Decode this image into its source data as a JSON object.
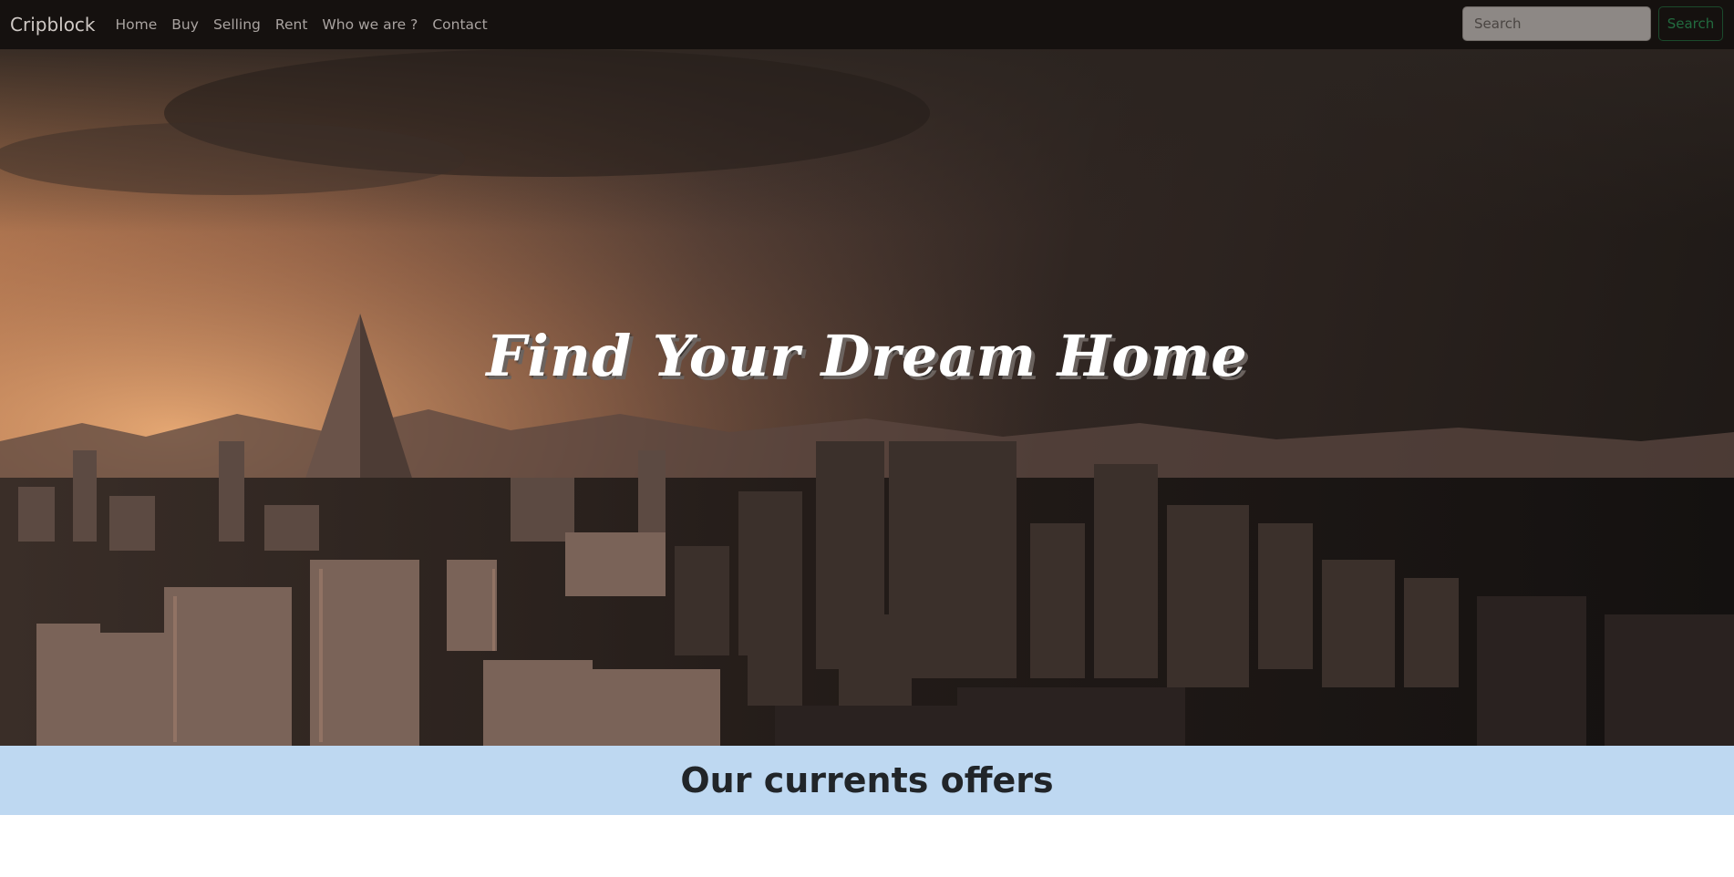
{
  "navbar": {
    "brand": "Cripblock",
    "links": [
      "Home",
      "Buy",
      "Selling",
      "Rent",
      "Who we are ?",
      "Contact"
    ],
    "search_placeholder": "Search",
    "search_button": "Search"
  },
  "hero": {
    "title": "Find Your Dream Home"
  },
  "offers": {
    "title": "Our currents offers"
  },
  "colors": {
    "navbar_bg": "#15110f",
    "banner_bg": "#bed8f1",
    "search_button": "#226b3f"
  }
}
